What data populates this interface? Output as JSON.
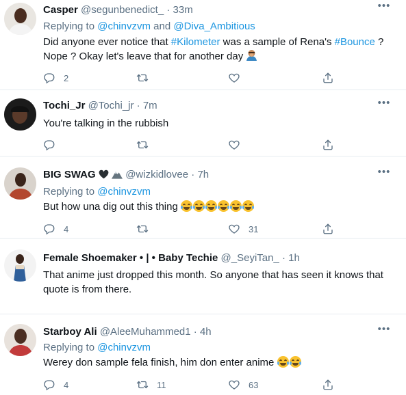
{
  "tweets": [
    {
      "name": "Casper",
      "handle": "@segunbenedict_",
      "dot": "·",
      "time": "33m",
      "replying_prefix": "Replying to ",
      "replying_to": [
        "@chinvzvm",
        "@Diva_Ambitious"
      ],
      "replying_joiner": " and ",
      "body_parts": [
        "Did anyone ever notice that ",
        "#Kilometer",
        " was a sample of Rena's ",
        "#Bounce",
        " ?",
        "Nope ? Okay let's leave that for another day "
      ],
      "emoji": "person-facepalming",
      "reply_count": "2",
      "retweet_count": "",
      "like_count": ""
    },
    {
      "name": "Tochi_Jr",
      "handle": "@Tochi_jr",
      "dot": "·",
      "time": "7m",
      "body": "You're talking in the rubbish",
      "reply_count": "",
      "retweet_count": "",
      "like_count": ""
    },
    {
      "name": "BIG SWAG",
      "name_emojis": [
        "black-heart",
        "snow-capped-mountain"
      ],
      "handle": "@wizkidlovee",
      "dot": "·",
      "time": "7h",
      "replying_prefix": "Replying to ",
      "replying_to": [
        "@chinvzvm"
      ],
      "body": "But how una dig out this thing ",
      "body_emoji_count": 6,
      "reply_count": "4",
      "retweet_count": "",
      "like_count": "31"
    },
    {
      "name": "Female Shoemaker • | • Baby Techie",
      "handle": "@_SeyiTan_",
      "dot": "·",
      "time": "1h",
      "body": "That anime just dropped this month. So anyone that has seen it knows that quote is from there.",
      "reply_count": "",
      "retweet_count": "",
      "like_count": ""
    },
    {
      "name": "Starboy Ali",
      "handle": "@AleeMuhammed1",
      "dot": "·",
      "time": "4h",
      "replying_prefix": "Replying to ",
      "replying_to": [
        "@chinvzvm"
      ],
      "body": "Werey don sample fela finish, him don enter anime ",
      "body_emoji_count": 2,
      "reply_count": "4",
      "retweet_count": "11",
      "like_count": "63"
    }
  ],
  "icons": {
    "reply": "reply-icon",
    "retweet": "retweet-icon",
    "like": "like-icon",
    "share": "share-icon",
    "more": "more-icon"
  },
  "colors": {
    "link": "#1b95e0",
    "secondary_text": "#5b7083",
    "divider": "#e6ecf0"
  }
}
